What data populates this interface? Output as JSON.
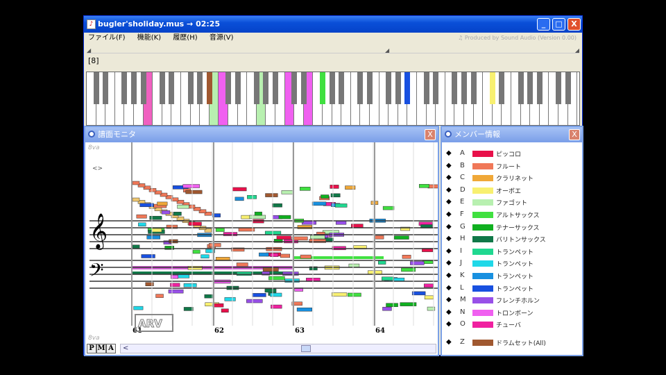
{
  "window": {
    "title": "bugler'sholiday.mus → 02:25",
    "minimize": "_",
    "maximize": "□",
    "close": "X"
  },
  "menu": {
    "items": [
      "ファイル(F)",
      "機能(K)",
      "履歴(H)",
      "音源(V)"
    ],
    "produced": "♫ Produced by Sound Audio (Version 0.00)"
  },
  "octave": "[8]",
  "score_panel": {
    "title": "譜面モニタ",
    "ottava_top": "8va",
    "ottava_bottom": "8va",
    "mark": "<>",
    "measures": [
      "61",
      "62",
      "63",
      "64"
    ],
    "tabs": [
      "P",
      "M",
      "A"
    ],
    "watermark": "ARV",
    "close": "X",
    "scroll_left": "<"
  },
  "member_panel": {
    "title": "メンバー情報",
    "close": "X",
    "members": [
      {
        "letter": "A",
        "color": "#e8104a",
        "name": "ピッコロ"
      },
      {
        "letter": "B",
        "color": "#f07858",
        "name": "フルート"
      },
      {
        "letter": "C",
        "color": "#f0a838",
        "name": "クラリネット"
      },
      {
        "letter": "D",
        "color": "#f8f070",
        "name": "オーボエ"
      },
      {
        "letter": "E",
        "color": "#b8f0b0",
        "name": "ファゴット"
      },
      {
        "letter": "F",
        "color": "#40e040",
        "name": "アルトサックス"
      },
      {
        "letter": "G",
        "color": "#10b020",
        "name": "テナーサックス"
      },
      {
        "letter": "H",
        "color": "#107848",
        "name": "バリトンサックス"
      },
      {
        "letter": "I",
        "color": "#20d890",
        "name": "トランペット"
      },
      {
        "letter": "J",
        "color": "#20d8e8",
        "name": "トランペット"
      },
      {
        "letter": "K",
        "color": "#1890e0",
        "name": "トランペット"
      },
      {
        "letter": "L",
        "color": "#1850e0",
        "name": "トランペット"
      },
      {
        "letter": "M",
        "color": "#9850e8",
        "name": "フレンチホルン"
      },
      {
        "letter": "N",
        "color": "#f060f0",
        "name": "トロンボーン"
      },
      {
        "letter": "O",
        "color": "#f020a0",
        "name": "チューバ"
      },
      {
        "letter": "Z",
        "color": "#a05830",
        "name": "ドラムセット(All)"
      }
    ]
  }
}
